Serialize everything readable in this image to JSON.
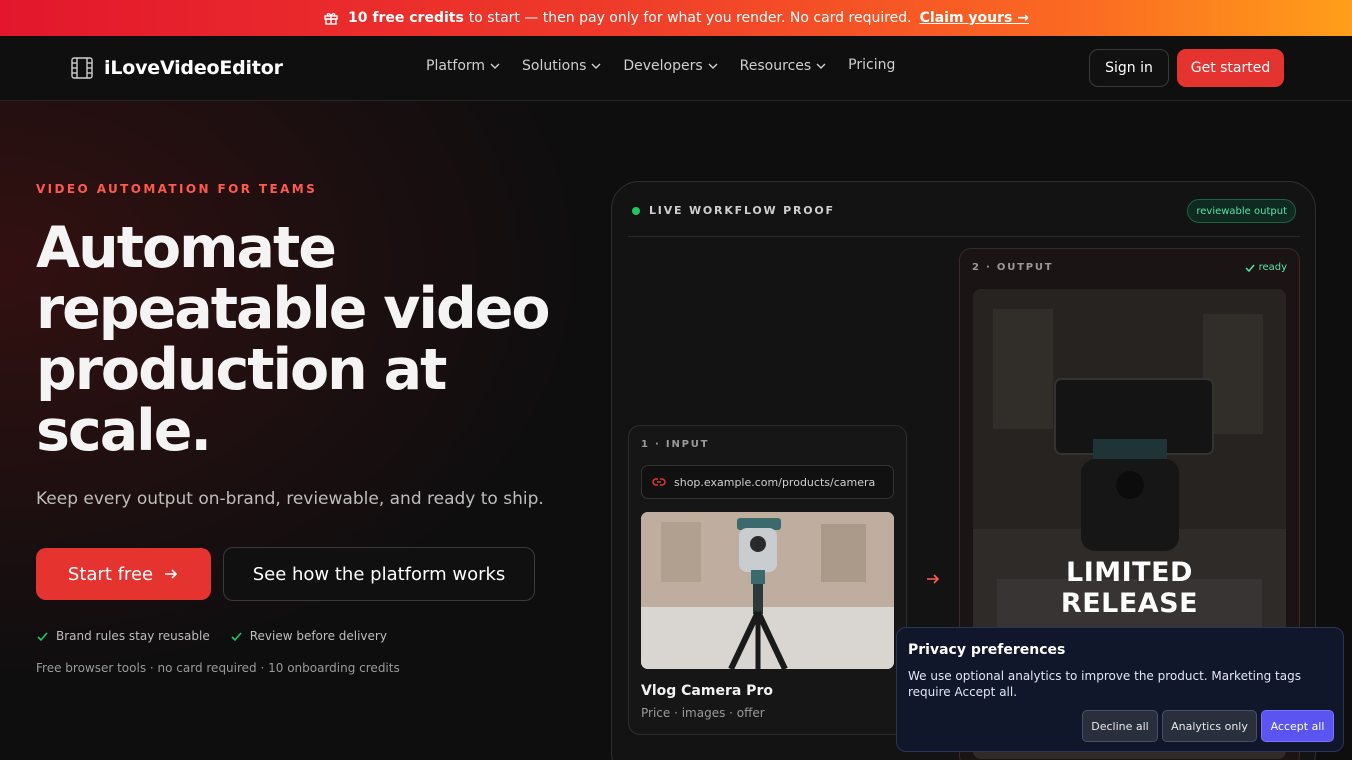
{
  "promo": {
    "bold": "10 free credits",
    "text": "to start — then pay only for what you render. No card required.",
    "link": "Claim yours →"
  },
  "header": {
    "brand": "iLoveVideoEditor",
    "nav": [
      "Platform",
      "Solutions",
      "Developers",
      "Resources",
      "Pricing"
    ],
    "signin": "Sign in",
    "get_started": "Get started"
  },
  "hero": {
    "eyebrow": "VIDEO AUTOMATION FOR TEAMS",
    "headline": "Automate repeatable video production at scale.",
    "subheadline": "Keep every output on-brand, reviewable, and ready to ship.",
    "primary_cta": "Start free",
    "secondary_cta": "See how the platform works",
    "checks": [
      "Brand rules stay reusable",
      "Review before delivery"
    ],
    "footnote": "Free browser tools · no card required · 10 onboarding credits"
  },
  "workflow": {
    "label": "LIVE WORKFLOW PROOF",
    "badge": "reviewable output",
    "input": {
      "label": "1 · INPUT",
      "url": "shop.example.com/products/camera",
      "product_name": "Vlog Camera Pro",
      "product_meta": "Price · images · offer"
    },
    "output": {
      "label": "2 · OUTPUT",
      "status": "ready",
      "overlay_line1": "LIMITED",
      "overlay_line2": "RELEASE"
    }
  },
  "privacy": {
    "title": "Privacy preferences",
    "text": "We use optional analytics to improve the product. Marketing tags require Accept all.",
    "decline": "Decline all",
    "analytics": "Analytics only",
    "accept": "Accept all"
  },
  "colors": {
    "accent": "#e5332f",
    "success": "#22c55e",
    "privacy_accept": "#5b54f0"
  }
}
